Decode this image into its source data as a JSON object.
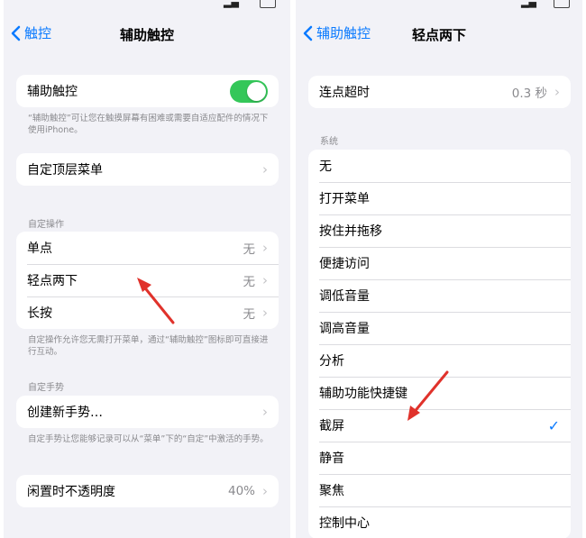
{
  "left": {
    "back_label": "触控",
    "title": "辅助触控",
    "assistive_touch": {
      "label": "辅助触控",
      "enabled": true
    },
    "assistive_note": "“辅助触控”可让您在触摸屏幕有困难或需要自适应配件的情况下使用iPhone。",
    "customize_menu": "自定顶层菜单",
    "custom_actions_header": "自定操作",
    "actions": [
      {
        "label": "单点",
        "value": "无"
      },
      {
        "label": "轻点两下",
        "value": "无"
      },
      {
        "label": "长按",
        "value": "无"
      }
    ],
    "actions_note": "自定操作允许您无需打开菜单，通过“辅助触控”图标即可直接进行互动。",
    "gestures_header": "自定手势",
    "create_gesture": "创建新手势…",
    "gestures_note": "自定手势让您能够记录可以从“菜单”下的“自定”中激活的手势。",
    "idle_opacity": {
      "label": "闲置时不透明度",
      "value": "40%"
    }
  },
  "right": {
    "back_label": "辅助触控",
    "title": "轻点两下",
    "timeout": {
      "label": "连点超时",
      "value": "0.3 秒"
    },
    "system_header": "系统",
    "options": [
      "无",
      "打开菜单",
      "按住并拖移",
      "便捷访问",
      "调低音量",
      "调高音量",
      "分析",
      "辅助功能快捷键",
      "截屏",
      "静音",
      "聚焦",
      "控制中心"
    ],
    "selected_option": "截屏"
  },
  "colors": {
    "accent": "#0a7aff",
    "toggle_on": "#34c759",
    "annotation_arrow": "#e0322b"
  }
}
